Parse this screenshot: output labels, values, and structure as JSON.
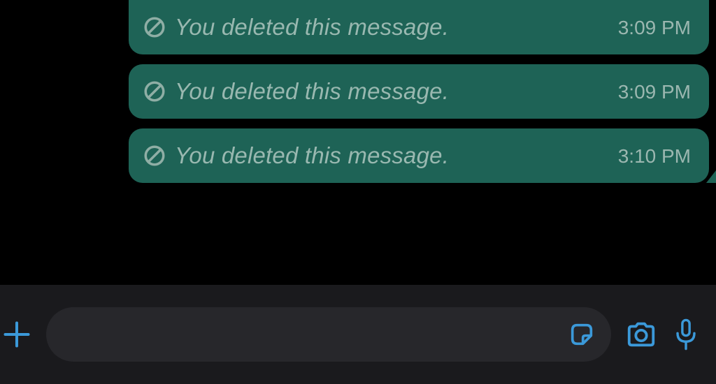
{
  "chat": {
    "messages": [
      {
        "text": "You deleted this message.",
        "time": "3:09 PM"
      },
      {
        "text": "You deleted this message.",
        "time": "3:09 PM"
      },
      {
        "text": "You deleted this message.",
        "time": "3:10 PM"
      }
    ]
  },
  "input": {
    "placeholder": ""
  },
  "colors": {
    "bubble": "#1e6356",
    "inputBarBg": "#1a1a1d",
    "inputFieldBg": "#27272b",
    "accent": "#3b99d9"
  }
}
